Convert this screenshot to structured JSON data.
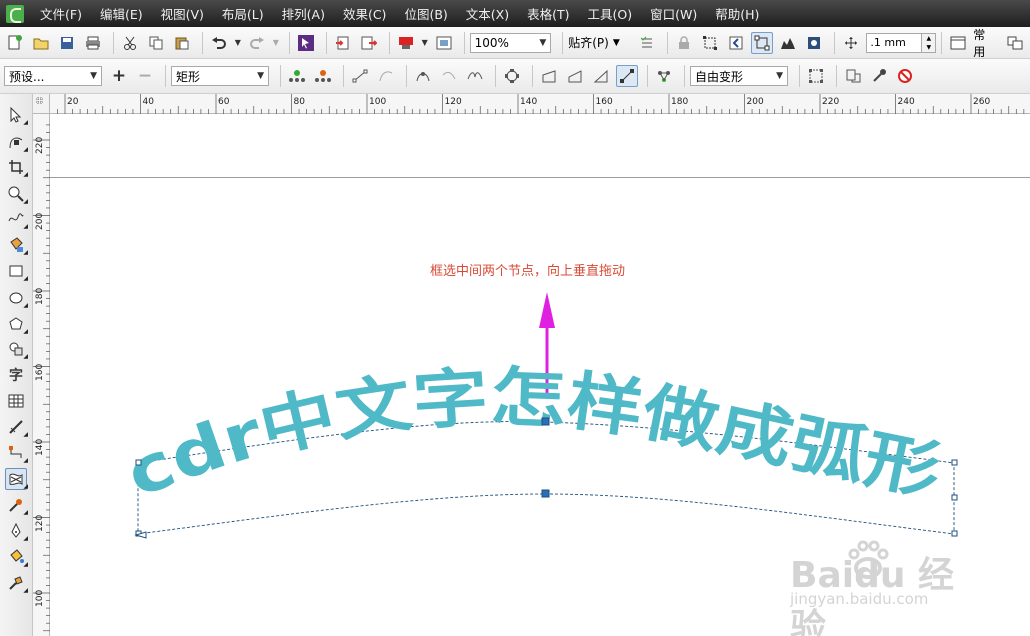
{
  "menubar": {
    "items": [
      "文件(F)",
      "编辑(E)",
      "视图(V)",
      "布局(L)",
      "排列(A)",
      "效果(C)",
      "位图(B)",
      "文本(X)",
      "表格(T)",
      "工具(O)",
      "窗口(W)",
      "帮助(H)"
    ]
  },
  "toolbar1": {
    "zoom": "100%",
    "snap": "贴齐(P)",
    "nudge": ".1 mm",
    "workspace": "常用"
  },
  "toolbar2": {
    "preset": "预设...",
    "shape": "矩形",
    "transform_mode": "自由变形"
  },
  "rulers": {
    "horizontal": [
      "20",
      "40",
      "60",
      "80",
      "100",
      "120",
      "140",
      "160",
      "180",
      "200",
      "220",
      "240",
      "260"
    ],
    "vertical": [
      "220",
      "200",
      "180",
      "160",
      "140",
      "120",
      "100"
    ]
  },
  "canvas": {
    "annotation": "框选中间两个节点，向上垂直拖动",
    "art_text": "cdr中文字怎样做成弧形",
    "text_color": "#4fb9c8",
    "arrow_color": "#e020e0"
  },
  "watermark": {
    "logo_text": "Baidu 经验",
    "url": "jingyan.baidu.com"
  }
}
